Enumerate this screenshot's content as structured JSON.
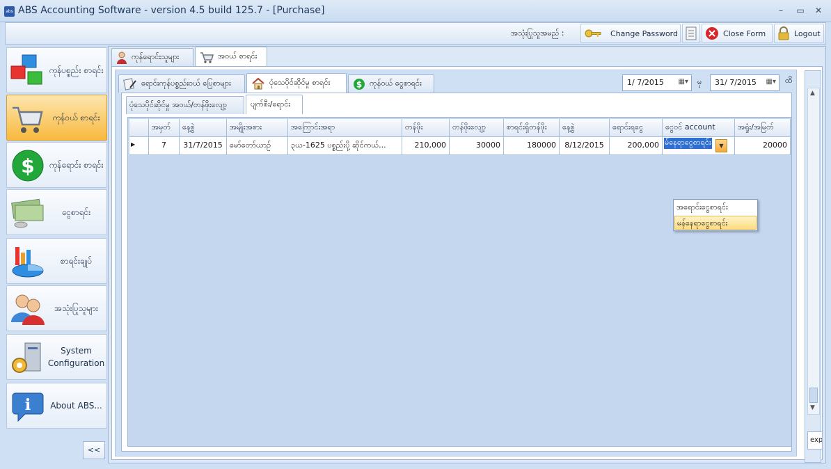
{
  "window": {
    "icon_text": "abs",
    "title": "ABS Accounting Software - version 4.5 build 125.7 - [Purchase]",
    "minimize": "–",
    "maximize": "▭",
    "close": "✕"
  },
  "toolbar": {
    "user_label": "အသုံးပြုသူအမည် :",
    "change_password": "Change Password",
    "close_form": "Close Form",
    "logout": "Logout"
  },
  "sidebar": {
    "items": [
      {
        "label": "ကုန်ပစ္စည်း စာရင်း",
        "icon": "cubes-icon"
      },
      {
        "label": "ကုန်ဝယ် စာရင်း",
        "icon": "shopping-cart-icon"
      },
      {
        "label": "ကုန်ရောင်း စာရင်း",
        "icon": "dollar-icon"
      },
      {
        "label": "ငွေစာရင်း",
        "icon": "cash-icon"
      },
      {
        "label": "စာရင်းချုပ်",
        "icon": "report-chart-icon"
      },
      {
        "label": "အသုံးပြုသူများ",
        "icon": "users-icon"
      },
      {
        "label": "System Configuration",
        "icon": "system-config-icon"
      },
      {
        "label": "About ABS...",
        "icon": "info-icon"
      }
    ],
    "collapse": "<<"
  },
  "tabs": {
    "top": [
      "ကုန်ရောင်းသူများ",
      "အဝယ် စာရင်း"
    ],
    "second": [
      "ရောင်းကုန်ပစ္စည်းဝယ် ပြေစာများ",
      "ပုံသေပိုင်ဆိုင်မှု စာရင်း",
      "ကုန်ဝယ် ငွေစာရင်း"
    ],
    "third": [
      "ပုံသေပိုင်ဆိုင်မှု အဝယ်/တန်ဖိုးလျော့",
      "ပျက်စီး/ရောင်း"
    ]
  },
  "filter": {
    "date_from": "1/ 7/2015",
    "separator": "မှ",
    "date_to": "31/ 7/2015",
    "suffix": "ထိ"
  },
  "grid": {
    "columns": [
      "အမှတ်",
      "နေ့စွဲ",
      "အမျိုးအစား",
      "အကြောင်းအရာ",
      "တန်ဖိုး",
      "တန်ဖိုးလျော့",
      "စာရင်းရှိတန်ဖိုး",
      "နေ့စွဲ",
      "ရောင်းရငွေ",
      "ငွေဝင် account",
      "အရှုံး/အမြတ်"
    ],
    "row": [
      "7",
      "31/7/2015",
      "မော်တော်ယာဉ်",
      "၃ယ-1625 ပစ္စည်းပို့ ဆိုင်ကယ်...",
      "210,000",
      "30000",
      "180000",
      "8/12/2015",
      "200,000",
      "မ်နေရာငွေစာရင်း",
      "20000"
    ]
  },
  "dropdown": {
    "options": [
      "အရောင်းငွေစာရင်း",
      "မန်နေရာငွေစာရင်း"
    ]
  },
  "export_label": "exp"
}
